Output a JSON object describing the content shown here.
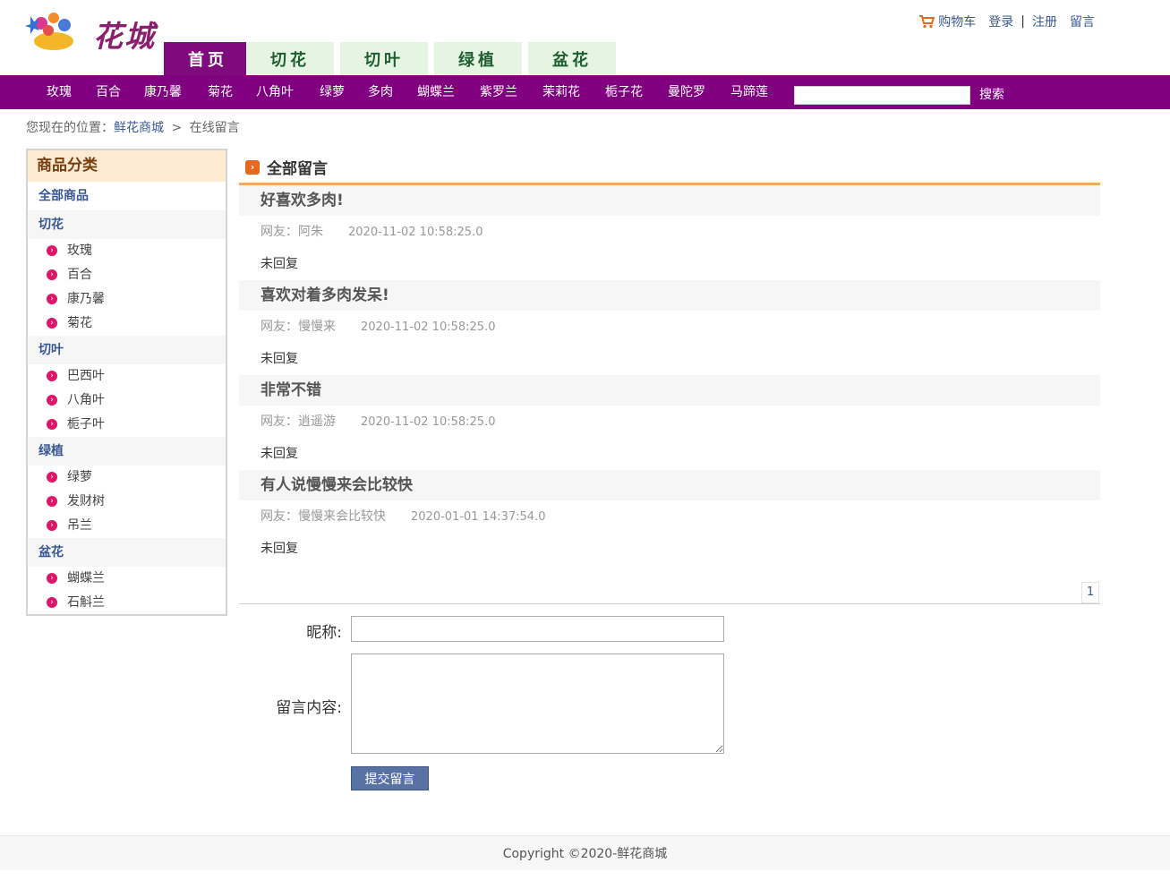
{
  "logo": {
    "text": "花城"
  },
  "toplinks": {
    "cart": "购物车",
    "login": "登录",
    "sep": "|",
    "register": "注册",
    "message": "留言"
  },
  "tabs": [
    "首页",
    "切花",
    "切叶",
    "绿植",
    "盆花"
  ],
  "subnav": [
    "玫瑰",
    "百合",
    "康乃馨",
    "菊花",
    "八角叶",
    "绿萝",
    "多肉",
    "蝴蝶兰",
    "紫罗兰",
    "茉莉花",
    "栀子花",
    "曼陀罗",
    "马蹄莲"
  ],
  "search": {
    "button": "搜索",
    "placeholder": ""
  },
  "breadcrumb": {
    "prefix": "您现在的位置：",
    "home": "鲜花商城",
    "sep": ">",
    "current": "在线留言"
  },
  "sidebar": {
    "title": "商品分类",
    "all": "全部商品",
    "groups": [
      {
        "name": "切花",
        "items": [
          "玫瑰",
          "百合",
          "康乃馨",
          "菊花"
        ]
      },
      {
        "name": "切叶",
        "items": [
          "巴西叶",
          "八角叶",
          "栀子叶"
        ]
      },
      {
        "name": "绿植",
        "items": [
          "绿萝",
          "发财树",
          "吊兰"
        ]
      },
      {
        "name": "盆花",
        "items": [
          "蝴蝶兰",
          "石斛兰"
        ]
      }
    ]
  },
  "main": {
    "title": "全部留言"
  },
  "messages": [
    {
      "title": "好喜欢多肉!",
      "author": "网友：阿朱",
      "time": "2020-11-02 10:58:25.0",
      "reply": "未回复"
    },
    {
      "title": "喜欢对着多肉发呆!",
      "author": "网友：慢慢来",
      "time": "2020-11-02 10:58:25.0",
      "reply": "未回复"
    },
    {
      "title": "非常不错",
      "author": "网友：逍遥游",
      "time": "2020-11-02 10:58:25.0",
      "reply": "未回复"
    },
    {
      "title": "有人说慢慢来会比较快",
      "author": "网友：慢慢来会比较快",
      "time": "2020-01-01 14:37:54.0",
      "reply": "未回复"
    }
  ],
  "pager": {
    "page": "1"
  },
  "form": {
    "nick_label": "昵称:",
    "content_label": "留言内容:",
    "nick_value": "",
    "content_value": "",
    "submit": "提交留言"
  },
  "footer": {
    "text": "Copyright ©2020-鲜花商城"
  },
  "colors": {
    "nav_purple": "#800080",
    "tab_active": "#7f0a7c",
    "tab_bg": "#e5f4e3",
    "link_blue": "#3a5795",
    "accent_orange": "#f0a868"
  }
}
